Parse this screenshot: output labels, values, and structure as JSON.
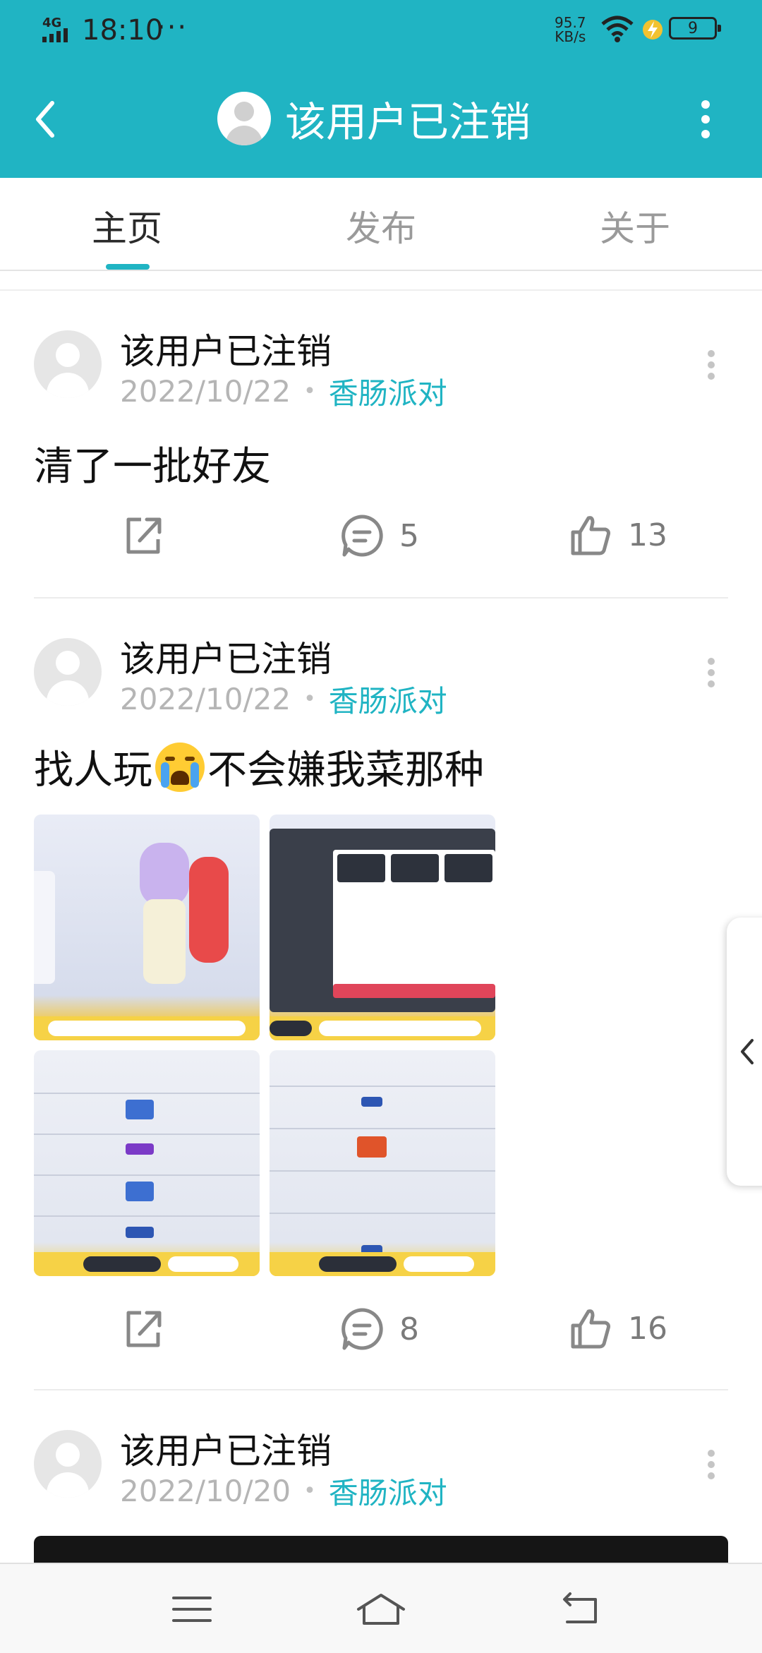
{
  "status_bar": {
    "network": "4G",
    "time": "18:10",
    "more": "···",
    "speed_value": "95.7",
    "speed_unit": "KB/s",
    "battery": "9"
  },
  "header": {
    "title": "该用户已注销",
    "background": "#20b4c3"
  },
  "tabs": [
    {
      "label": "主页",
      "active": true
    },
    {
      "label": "发布",
      "active": false
    },
    {
      "label": "关于",
      "active": false
    }
  ],
  "posts": [
    {
      "author": "该用户已注销",
      "date": "2022/10/22",
      "game": "香肠派对",
      "text": "清了一批好友",
      "comments": "5",
      "likes": "13"
    },
    {
      "author": "该用户已注销",
      "date": "2022/10/22",
      "game": "香肠派对",
      "text_before": "找人玩",
      "emoji": "loudly-crying-face",
      "text_after": "不会嫌我菜那种",
      "comments": "8",
      "likes": "16"
    },
    {
      "author": "该用户已注销",
      "date": "2022/10/20",
      "game": "香肠派对"
    }
  ],
  "colors": {
    "accent": "#20b4c3",
    "meta_gray": "#b5b5b5"
  }
}
